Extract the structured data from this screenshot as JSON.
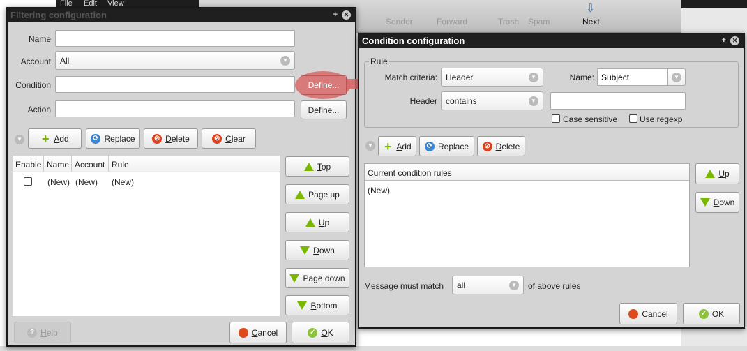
{
  "background": {
    "menu": [
      "File",
      "Edit",
      "View"
    ],
    "toolbar": [
      "Sender",
      "Forward",
      "Trash",
      "Spam",
      "Next"
    ]
  },
  "filter": {
    "title": "Filtering configuration",
    "name_label": "Name",
    "name_value": "",
    "account_label": "Account",
    "account_value": "All",
    "condition_label": "Condition",
    "condition_value": "",
    "action_label": "Action",
    "action_value": "",
    "define": "Define...",
    "toolbar": {
      "add": "Add",
      "replace": "Replace",
      "delete": "Delete",
      "clear": "Clear"
    },
    "columns": [
      "Enable",
      "Name",
      "Account",
      "Rule"
    ],
    "rows": [
      {
        "enabled": false,
        "name": "(New)",
        "account": "(New)",
        "rule": "(New)"
      }
    ],
    "move": {
      "top": "Top",
      "page_up": "Page up",
      "up": "Up",
      "down": "Down",
      "page_down": "Page down",
      "bottom": "Bottom"
    },
    "help": "Help",
    "cancel": "Cancel",
    "ok": "OK"
  },
  "condition": {
    "title": "Condition configuration",
    "rule_legend": "Rule",
    "match_label": "Match criteria:",
    "match_value": "Header",
    "name_label": "Name:",
    "name_value": "Subject",
    "header_label": "Header",
    "header_op": "contains",
    "header_value": "",
    "case_sensitive": "Case sensitive",
    "case_checked": false,
    "use_regexp": "Use regexp",
    "regexp_checked": false,
    "toolbar": {
      "add": "Add",
      "replace": "Replace",
      "delete": "Delete"
    },
    "list_header": "Current condition rules",
    "items": [
      "(New)"
    ],
    "up": "Up",
    "down": "Down",
    "match_prefix": "Message must match",
    "match_mode": "all",
    "match_suffix": "of above rules",
    "cancel": "Cancel",
    "ok": "OK"
  },
  "colors": {
    "highlight": "#d96a6a",
    "title_bar": "#1f1f1f",
    "dialog_bg": "#d4d4d4"
  }
}
